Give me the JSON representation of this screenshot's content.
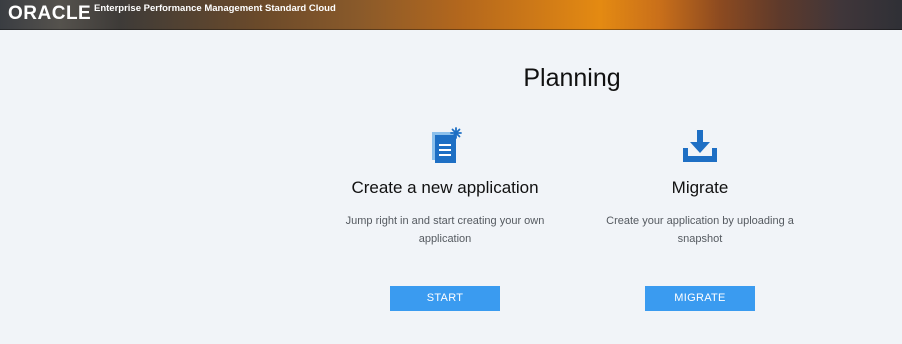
{
  "header": {
    "brand": "ORACLE",
    "product": "Enterprise Performance Management Standard Cloud"
  },
  "main": {
    "title": "Planning",
    "cards": [
      {
        "icon": "new-document-icon",
        "title": "Create a new application",
        "description": "Jump right in and start creating your own application",
        "button": "START"
      },
      {
        "icon": "download-icon",
        "title": "Migrate",
        "description": "Create your application by uploading a snapshot",
        "button": "MIGRATE"
      }
    ]
  },
  "colors": {
    "accent": "#3a9bf0",
    "icon": "#1e6fc4",
    "background": "#f1f4f8"
  }
}
